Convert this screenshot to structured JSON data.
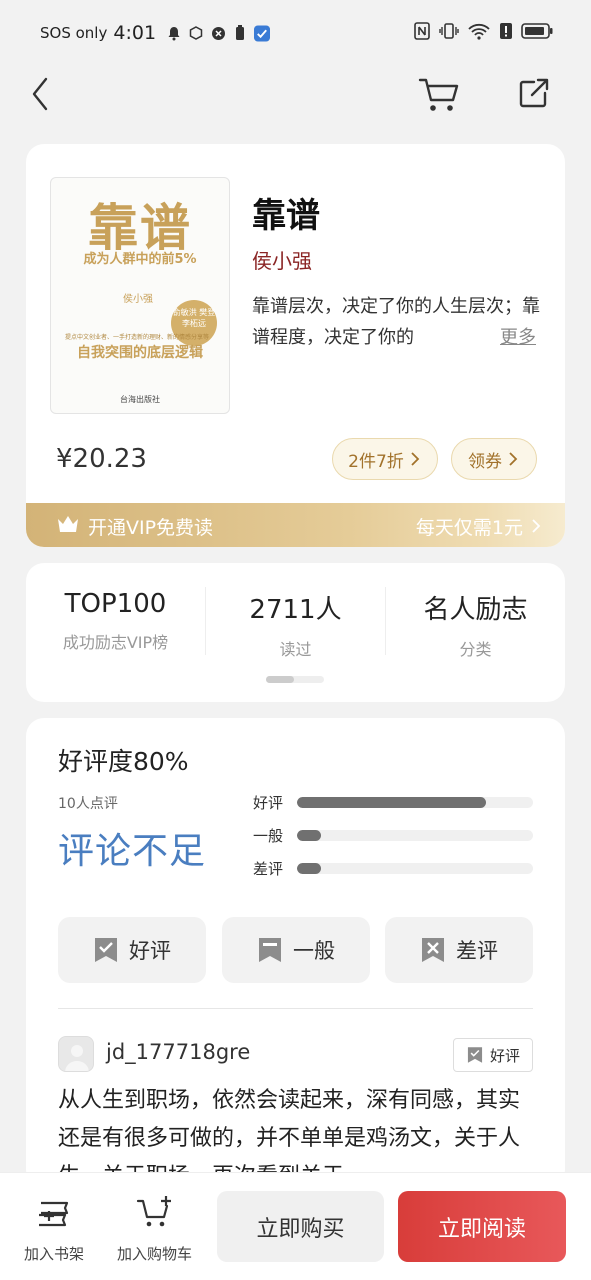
{
  "status_bar": {
    "network": "SOS only",
    "time": "4:01"
  },
  "book": {
    "title": "靠谱",
    "author": "侯小强",
    "description": "靠谱层次，决定了你的人生层次；靠谱程度，决定了你的",
    "more_label": "更多",
    "price": "¥20.23",
    "discount_label": "2件7折",
    "coupon_label": "领券",
    "cover": {
      "title": "靠谱",
      "subtitle": "成为人群中的前5%",
      "author": "侯小强",
      "badge": "俞敏洪 樊登 李柘远",
      "tagline": "提点中文创业者、一手打造新的理财、新的情感分享等",
      "slogan": "自我突围的底层逻辑",
      "publisher": "台海出版社"
    }
  },
  "vip": {
    "left_label": "开通VIP免费读",
    "right_label": "每天仅需1元"
  },
  "stats": [
    {
      "value": "TOP100",
      "label": "成功励志VIP榜"
    },
    {
      "value": "2711人",
      "label": "读过"
    },
    {
      "value": "名人励志",
      "label": "分类"
    }
  ],
  "review": {
    "rating_title": "好评度80%",
    "count_label": "10人点评",
    "status": "评论不足",
    "bars": [
      {
        "label": "好评",
        "fraction": 0.8
      },
      {
        "label": "一般",
        "fraction": 0.1
      },
      {
        "label": "差评",
        "fraction": 0.1
      }
    ],
    "buttons": [
      "好评",
      "一般",
      "差评"
    ],
    "comment": {
      "username": "jd_177718gre",
      "tag": "好评",
      "text": "从人生到职场，依然会读起来，深有同感，其实还是有很多可做的，并不单单是鸡汤文，关于人生，关于职场，再次看到关于"
    }
  },
  "bottom": {
    "shelf_label": "加入书架",
    "cart_label": "加入购物车",
    "buy_label": "立即购买",
    "read_label": "立即阅读"
  },
  "colors": {
    "accent_red": "#d83d3a",
    "gold": "#d3b377",
    "link_blue": "#4a7ec0",
    "author_red": "#8a2424"
  }
}
